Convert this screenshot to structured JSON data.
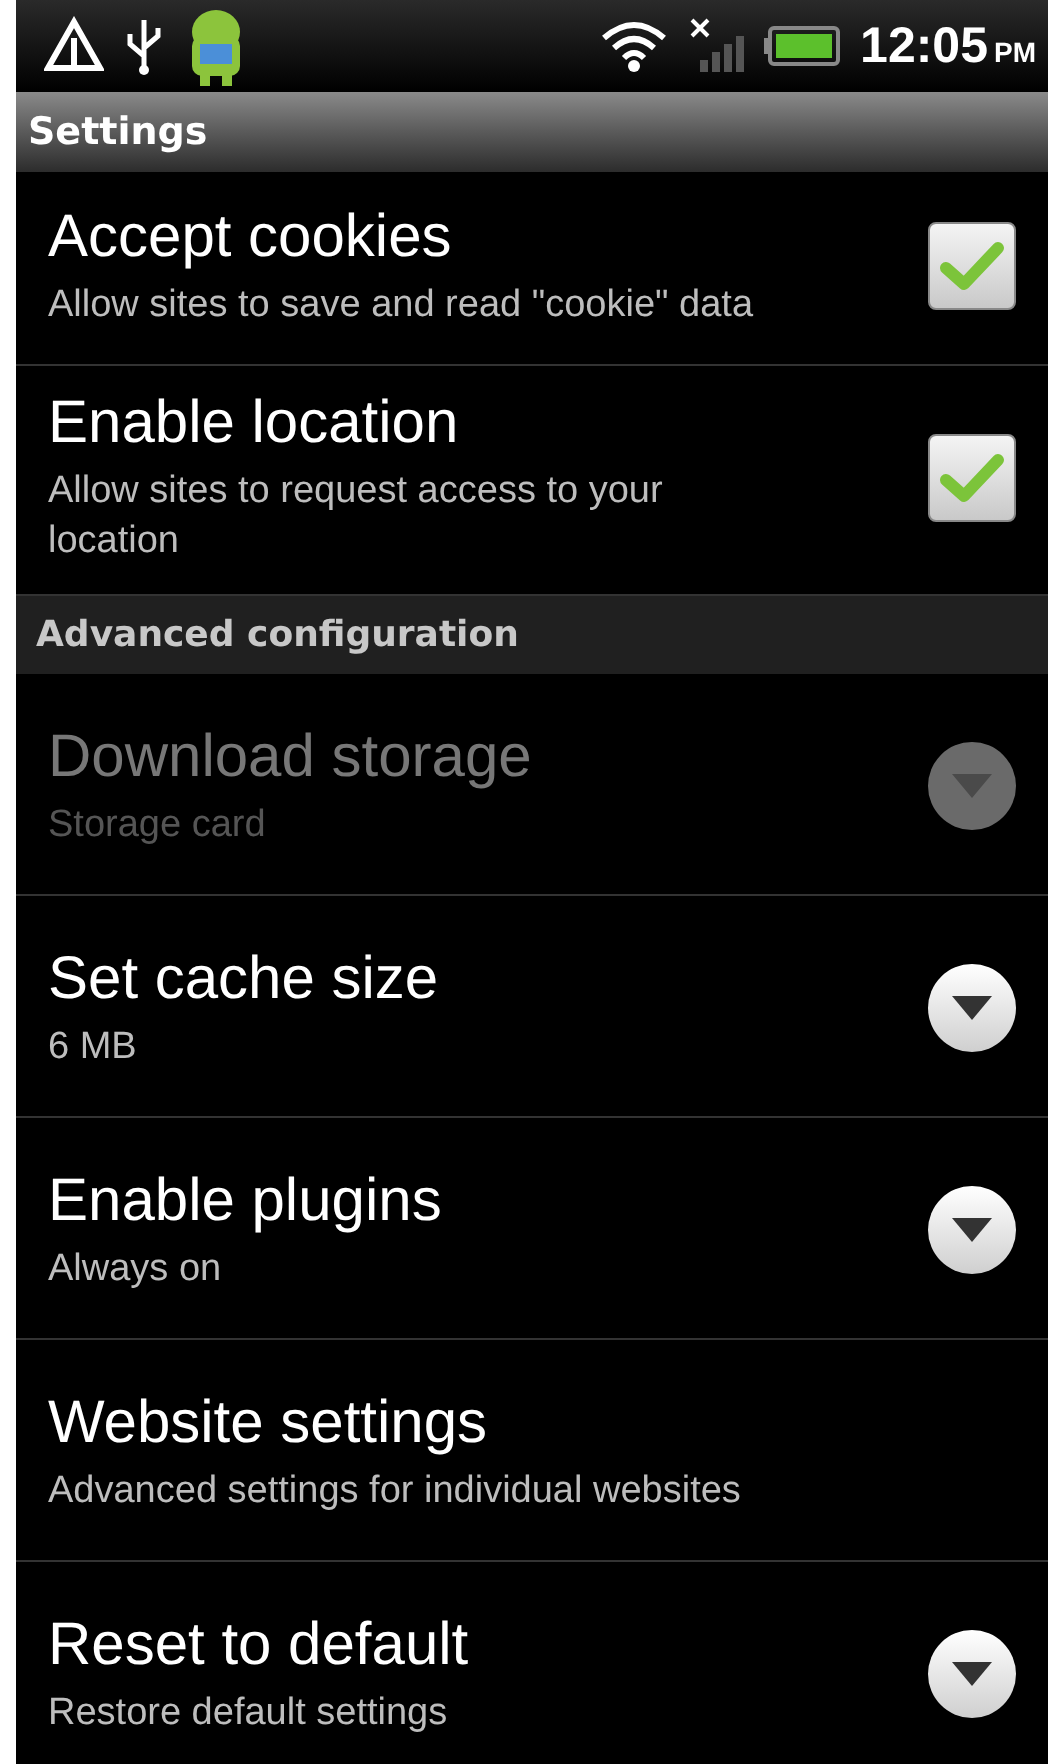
{
  "status_bar": {
    "time": "12:05",
    "meridiem": "PM"
  },
  "title": "Settings",
  "sections": [
    {
      "items": [
        {
          "title": "Accept cookies",
          "summary": "Allow sites to save and read \"cookie\" data",
          "kind": "checkbox",
          "checked": true,
          "disabled": false
        },
        {
          "title": "Enable location",
          "summary": "Allow sites to request access to your location",
          "kind": "checkbox",
          "checked": true,
          "disabled": false
        }
      ]
    },
    {
      "header": "Advanced configuration",
      "items": [
        {
          "title": "Download storage",
          "summary": "Storage card",
          "kind": "dropdown",
          "disabled": true
        },
        {
          "title": "Set cache size",
          "summary": "6 MB",
          "kind": "dropdown",
          "disabled": false
        },
        {
          "title": "Enable plugins",
          "summary": "Always on",
          "kind": "dropdown",
          "disabled": false
        },
        {
          "title": "Website settings",
          "summary": "Advanced settings for individual websites",
          "kind": "plain",
          "disabled": false
        },
        {
          "title": "Reset to default",
          "summary": "Restore default settings",
          "kind": "dropdown",
          "disabled": false
        }
      ]
    }
  ]
}
